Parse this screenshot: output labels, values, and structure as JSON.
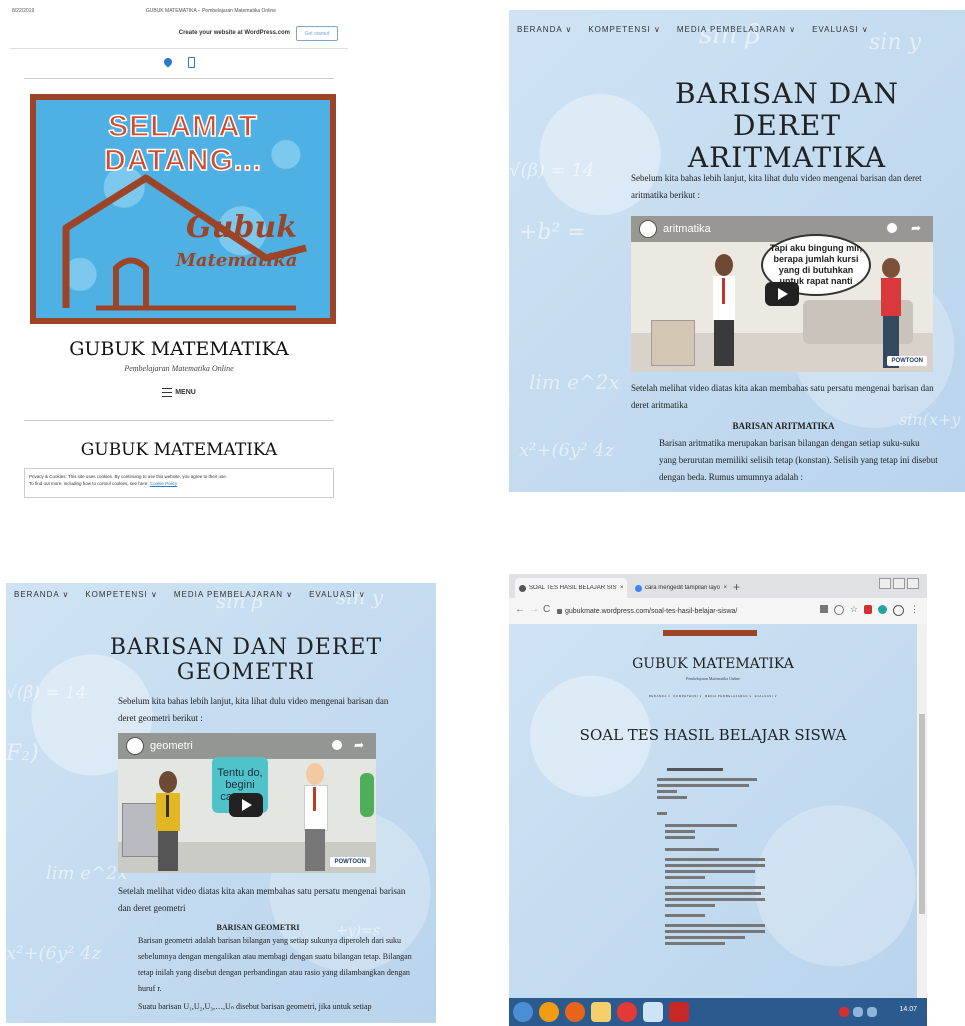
{
  "panel1": {
    "top_date": "8/22/2019",
    "top_title": "GUBUK MATEMATIKA – Pembelajaran Matematika Online",
    "wp_banner": "Create your website at WordPress.com",
    "get_started": "Get started",
    "banner_text": "SELAMAT DATANG...",
    "logo_line1": "Gubuk",
    "logo_line2": "Matematika",
    "site_title": "GUBUK MATEMATIKA",
    "tagline": "Pembelajaran Matematika Online",
    "menu_label": "MENU",
    "section_title": "GUBUK MATEMATIKA",
    "cookie_line1": "Privacy & Cookies: This site uses cookies. By continuing to use this website, you agree to their use.",
    "cookie_line2": "To find out more, including how to control cookies, see here:",
    "cookie_link": "Cookie Policy"
  },
  "nav": {
    "items": [
      "BERANDA ∨",
      "KOMPETENSI ∨",
      "MEDIA PEMBELAJARAN ∨",
      "EVALUASI ∨"
    ]
  },
  "panel2": {
    "title_line1": "BARISAN DAN DERET",
    "title_line2": "ARITMATIKA",
    "intro": "Sebelum kita bahas lebih lanjut, kita lihat dulu video mengenai barisan dan deret aritmatika berikut :",
    "video_title": "aritmatika",
    "bubble_text": "Tapi aku bingung mir, berapa jumlah kursi yang di butuhkan untuk rapat nanti",
    "after_video": "Setelah melihat video diatas kita akan membahas satu persatu mengenai barisan dan deret aritmatika",
    "section_heading": "BARISAN ARITMATIKA",
    "body": "Barisan aritmatika merupakan barisan bilangan dengan setiap suku-suku yang berurutan memiliki selisih tetap (konstan). Selisih yang tetap ini disebut dengan beda. Rumus umumnya adalah :",
    "powtoon": "POWTOON"
  },
  "panel3": {
    "title": "BARISAN DAN DERET GEOMETRI",
    "intro": "Sebelum kita bahas lebih lanjut, kita lihat dulu video mengenai barisan dan deret geometri berikut :",
    "video_title": "geometri",
    "bubble_text": "Tentu do, begini caranya",
    "after_video": "Setelah melihat video diatas kita akan membahas satu persatu mengenai barisan dan deret geometri",
    "section_heading": "BARISAN GEOMETRI",
    "body": "Barisan geometri adalah barisan bilangan yang setiap sukunya diperoleh dari suku sebelumnya dengan mengalikan atau membagi dengan suatu bilangan tetap. Bilangan tetap inilah yang disebut dengan perbandingan atau rasio yang dilambangkan dengan huruf r.",
    "formula": "Suatu barisan U₁,U₂,U₃,…,Uₙ disebut barisan geometri, jika untuk setiap",
    "powtoon": "POWTOON"
  },
  "panel4": {
    "tab1": "SOAL TES HASIL BELAJAR SISWA",
    "tab2": "cara mengedit tampilan layo",
    "url": "gubukmate.wordpress.com/soal-tes-hasil-belajar-siswa/",
    "site_title": "GUBUK MATEMATIKA",
    "tagline": "Pembelajaran Matematika Online",
    "page_title": "SOAL TES HASIL BELAJAR SISWA",
    "clock": "14.07"
  },
  "colors": {
    "page_bg": "#c6ddf0",
    "banner_blue": "#4fb1e3",
    "banner_border": "#9b4428",
    "banner_text": "#d14a2a",
    "taskbar": "#2b5a8f"
  }
}
